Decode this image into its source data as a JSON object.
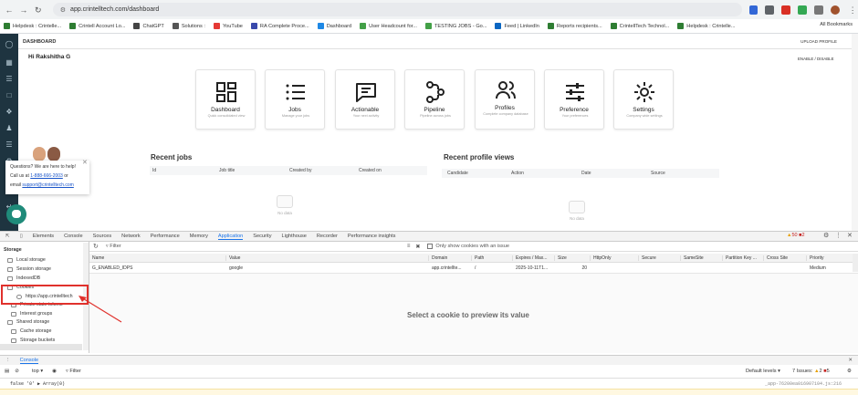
{
  "browser": {
    "url": "app.crintelltech.com/dashboard",
    "bookmarks": [
      "Helpdesk : Crintelle...",
      "Crintell Account Lo...",
      "ChatGPT",
      "Solutions :",
      "YouTube",
      "RA Complete Proce...",
      "Dashboard",
      "User Headcount for...",
      "TESTING JOBS - Go...",
      "Feed | LinkedIn",
      "Reports recipients...",
      "CrintellTech Technol...",
      "Helpdesk : Crintelle..."
    ],
    "all_bookmarks": "All Bookmarks"
  },
  "app": {
    "header_title": "DASHBOARD",
    "upload_profile": "UPLOAD PROFILE",
    "greeting": "Hi Rakshitha G",
    "enable_disable": "ENABLE / DISABLE",
    "cards": [
      {
        "title": "Dashboard",
        "subtitle": "Quick consolidated view",
        "icon": "dashboard-grid-icon"
      },
      {
        "title": "Jobs",
        "subtitle": "Manage your jobs",
        "icon": "list-icon"
      },
      {
        "title": "Actionable",
        "subtitle": "Your next activity",
        "icon": "chat-lines-icon"
      },
      {
        "title": "Pipeline",
        "subtitle": "Pipeline across jobs",
        "icon": "pipeline-icon"
      },
      {
        "title": "Profiles",
        "subtitle": "Complete company database",
        "icon": "people-icon"
      },
      {
        "title": "Preference",
        "subtitle": "Your preferences",
        "icon": "sliders-icon"
      },
      {
        "title": "Settings",
        "subtitle": "Company wide settings",
        "icon": "gear-icon"
      }
    ],
    "recent_jobs": {
      "title": "Recent jobs",
      "columns": [
        "Id",
        "Job title",
        "Created by",
        "Created on"
      ],
      "empty": "No data"
    },
    "recent_views": {
      "title": "Recent profile views",
      "columns": [
        "Candidate",
        "Action",
        "Date",
        "Source"
      ],
      "empty": "No data"
    },
    "help": {
      "line1": "Questions? We are here to help!",
      "line2_prefix": "Call us at",
      "phone": "1-888-666-2003",
      "line2_suffix": "or",
      "line3_prefix": "email",
      "email": "support@crintelltech.com"
    }
  },
  "devtools": {
    "tabs": [
      "Elements",
      "Console",
      "Sources",
      "Network",
      "Performance",
      "Memory",
      "Application",
      "Security",
      "Lighthouse",
      "Recorder",
      "Performance insights"
    ],
    "active_tab": "Application",
    "warnings_count": "50",
    "errors_count": "2",
    "storage_heading": "Storage",
    "tree": [
      "Local storage",
      "Session storage",
      "IndexedDB",
      "Cookies",
      "https://app.crintelltech",
      "Private state tokens",
      "Interest groups",
      "Shared storage",
      "Cache storage",
      "Storage buckets"
    ],
    "filter_placeholder": "Filter",
    "only_issue_label": "Only show cookies with an issue",
    "columns": [
      "Name",
      "Value",
      "Domain",
      "Path",
      "Expires / Max...",
      "Size",
      "HttpOnly",
      "Secure",
      "SameSite",
      "Partition Key ...",
      "Cross Site",
      "Priority"
    ],
    "cookie": {
      "name": "G_ENABLED_IDPS",
      "value": "google",
      "domain": "app.crintellte...",
      "path": "/",
      "expires": "2025-10-11T1...",
      "size": "20",
      "priority": "Medium"
    },
    "preview_text": "Select a cookie to preview its value",
    "console_tab": "Console",
    "context": "top",
    "console_filter": "Filter",
    "default_levels": "Default levels",
    "issues_label": "7 Issues:",
    "issues_warn": "2",
    "issues_err": "5",
    "console_output": "false '0' ▶ Array(0)",
    "console_source": "_app-76200ea016907104.js:216"
  }
}
